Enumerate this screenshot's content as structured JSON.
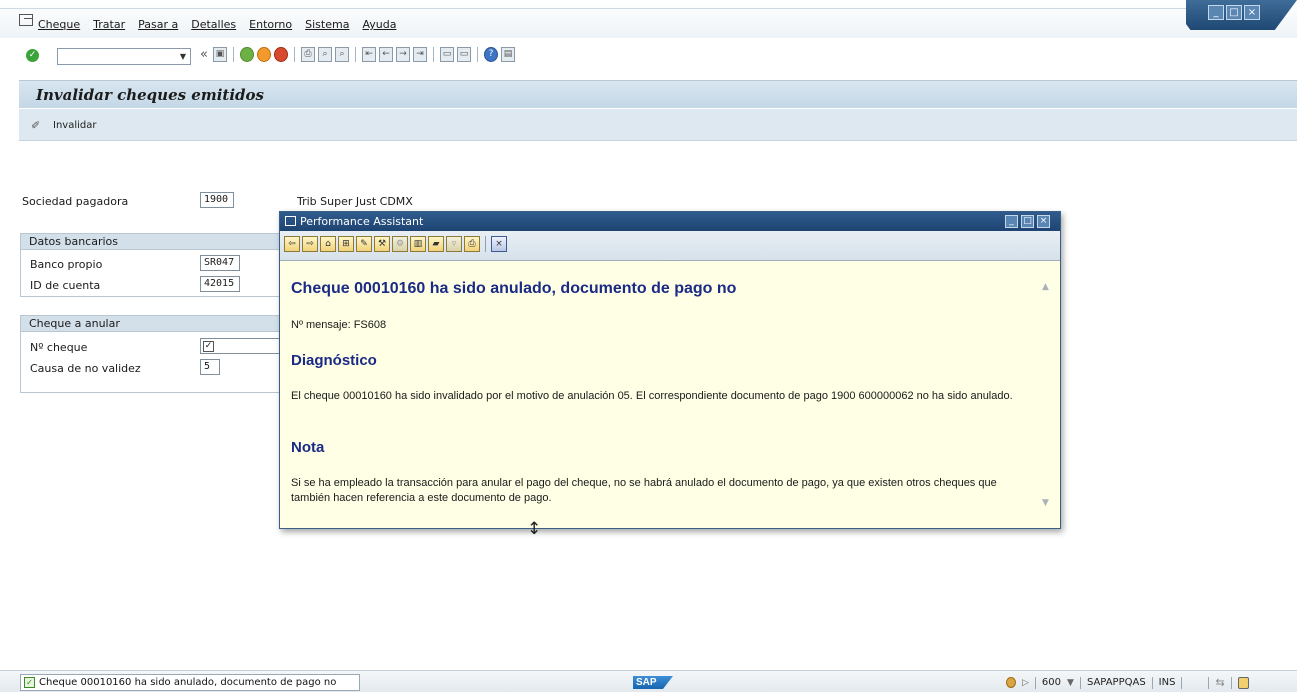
{
  "menubar": {
    "items": [
      "Cheque",
      "Tratar",
      "Pasar a",
      "Detalles",
      "Entorno",
      "Sistema",
      "Ayuda"
    ]
  },
  "toolbar": {
    "command_field_value": "",
    "icons": [
      "save-icon",
      "back-icon",
      "exit-icon",
      "cancel-icon",
      "print-icon",
      "find-icon",
      "find-next-icon",
      "first-page-icon",
      "previous-page-icon",
      "next-page-icon",
      "last-page-icon",
      "create-session-icon",
      "shortcut-icon",
      "help-icon",
      "customize-layout-icon"
    ]
  },
  "screen": {
    "title": "Invalidar cheques emitidos",
    "app_toolbar": {
      "invalidar_label": "Invalidar"
    }
  },
  "form": {
    "sociedad": {
      "label": "Sociedad pagadora",
      "value": "1900",
      "description": "Trib Super Just CDMX"
    },
    "datos_bancarios": {
      "title": "Datos bancarios",
      "banco_label": "Banco propio",
      "banco_value": "SR047",
      "cuenta_label": "ID de cuenta",
      "cuenta_value": "42015"
    },
    "cheque_anular": {
      "title": "Cheque a anular",
      "numero_label": "Nº cheque",
      "numero_value": "",
      "causa_label": "Causa de no validez",
      "causa_value": "5"
    }
  },
  "perf_assistant": {
    "title": "Performance Assistant",
    "heading": "Cheque 00010160 ha sido anulado, documento de pago no",
    "msg_number": "Nº mensaje: FS608",
    "diag_title": "Diagnóstico",
    "diag_text": "El cheque 00010160 ha sido invalidado por el motivo de anulación 05. El correspondiente documento de pago 1900 600000062 no ha sido anulado.",
    "nota_title": "Nota",
    "nota_text": "Si se ha empleado la transacción para anular el pago del cheque, no se habrá anulado el documento de pago, ya que existen otros cheques que también hacen referencia a este documento de pago."
  },
  "status_bar": {
    "message": "Cheque 00010160 ha sido anulado, documento de pago no",
    "logo_text": "SAP",
    "client": "600",
    "system": "SAPAPPQAS",
    "mode": "INS"
  },
  "colors": {
    "title_bar": "#c4d7e6",
    "pa_titlebar": "#1e4371",
    "pa_background": "#ffffe6",
    "pa_heading": "#1a2a85"
  }
}
